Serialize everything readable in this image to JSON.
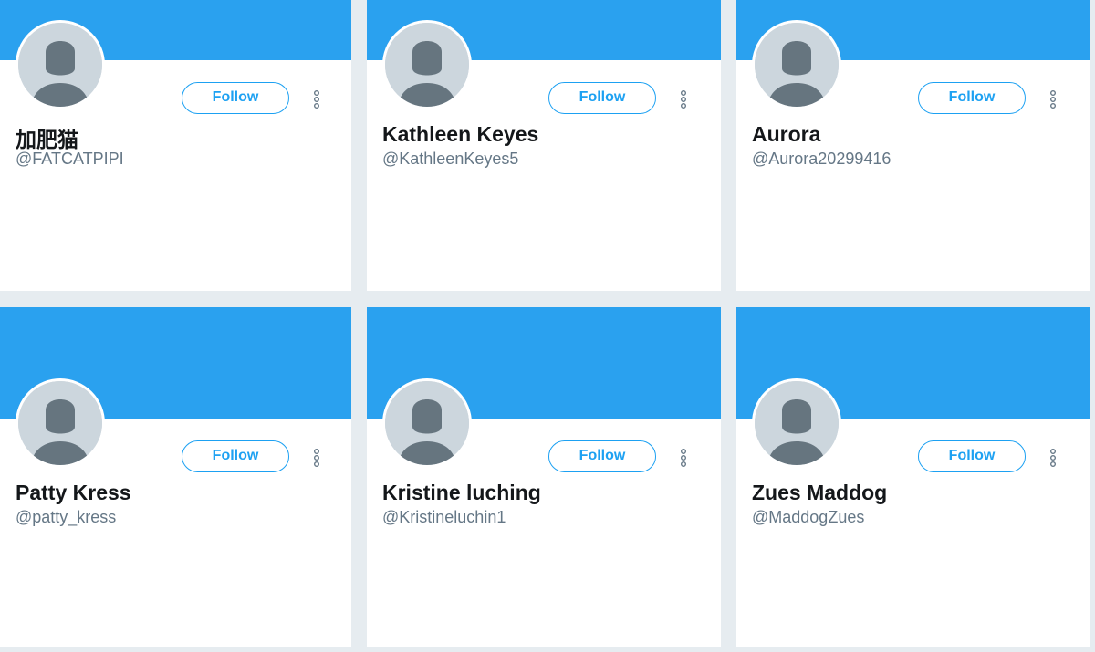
{
  "follow_label": "Follow",
  "colors": {
    "banner": "#2aa1ef",
    "accent": "#1da1f2",
    "page_background": "#e6ecf0",
    "name_text": "#14171a",
    "handle_text": "#657786",
    "avatar_background": "#ccd6dd",
    "avatar_silhouette": "#66757f"
  },
  "icons": {
    "avatar": "default-profile-silhouette",
    "more": "vertical-three-dots"
  },
  "cards": [
    {
      "name": "加肥猫",
      "handle": "@FATCATPIPI"
    },
    {
      "name": "Kathleen Keyes",
      "handle": "@KathleenKeyes5"
    },
    {
      "name": "Aurora",
      "handle": "@Aurora20299416"
    },
    {
      "name": "Patty Kress",
      "handle": "@patty_kress"
    },
    {
      "name": "Kristine luching",
      "handle": "@Kristineluchin1"
    },
    {
      "name": "Zues Maddog",
      "handle": "@MaddogZues"
    }
  ]
}
